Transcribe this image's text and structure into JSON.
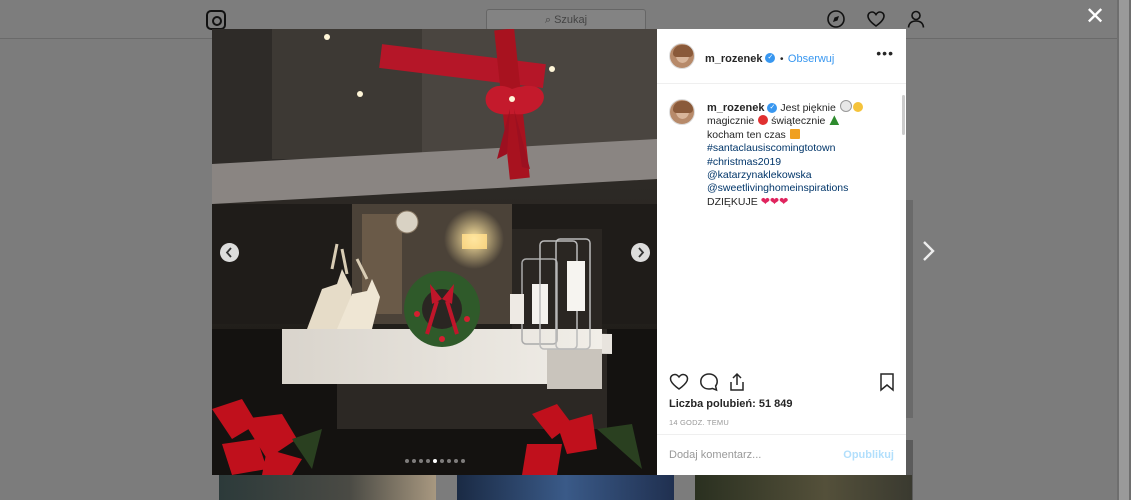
{
  "background": {
    "search_placeholder": "Szukaj",
    "icons": [
      "instagram-logo-icon",
      "explore-compass-icon",
      "activity-heart-icon",
      "profile-person-icon"
    ]
  },
  "modal": {
    "close_icon": "close-icon",
    "carousel": {
      "total_slides": 9,
      "active_slide": 5
    }
  },
  "post": {
    "username": "m_rozenek",
    "verified": true,
    "separator": "•",
    "follow_label": "Obserwuj",
    "more_icon": "•••",
    "caption": {
      "username": "m_rozenek",
      "line1": "Jest pięknie",
      "line2_a": "magicznie",
      "line2_b": "świątecznie",
      "line3": "kocham ten czas",
      "hashtag1": "#santaclausiscomingtotown",
      "hashtag2": "#christmas2019",
      "mention1": "@katarzynaklekowska",
      "mention2": "@sweetlivinghomeinspirations",
      "closing": "DZIĘKUJE"
    },
    "likes_label": "Liczba polubień:",
    "likes_count": "51 849",
    "timestamp": "14 GODZ. TEMU",
    "comment_placeholder": "Dodaj komentarz...",
    "publish_label": "Opublikuj"
  },
  "colors": {
    "link_blue": "#3897f0",
    "hashtag_blue": "#003569",
    "heart_red": "#e0245e",
    "bow_red": "#c0162a"
  }
}
